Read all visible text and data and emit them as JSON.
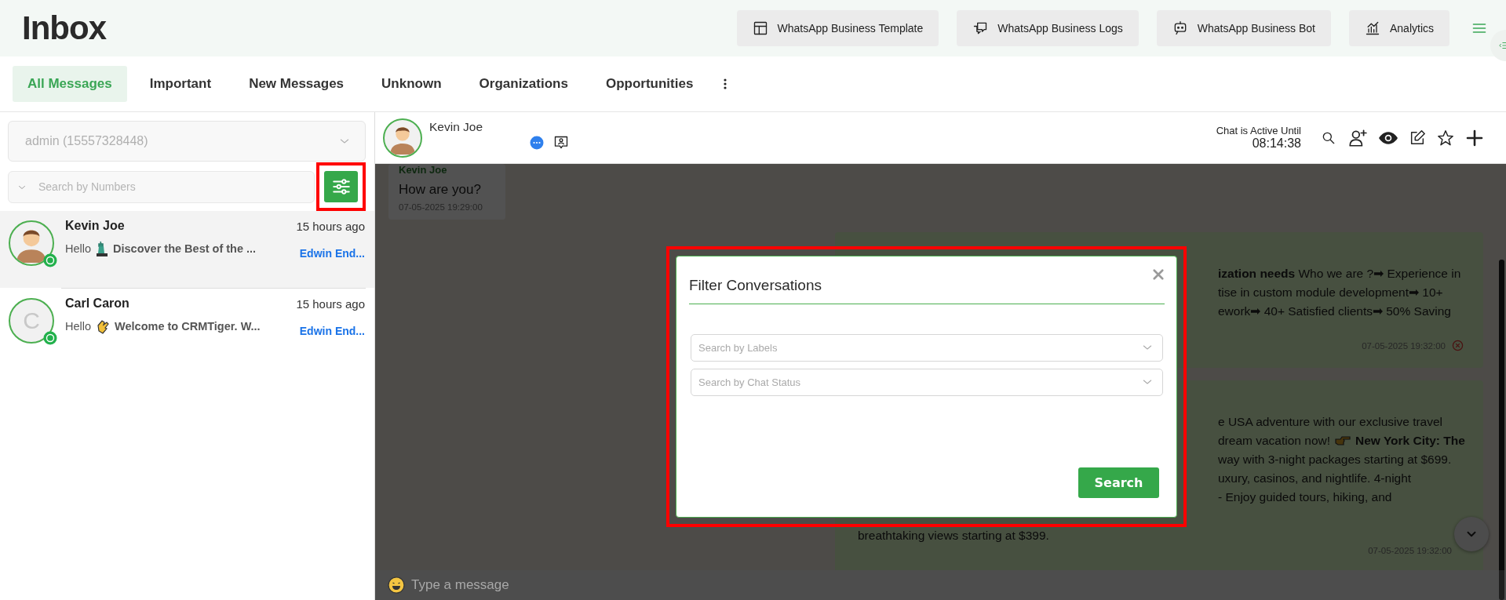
{
  "header": {
    "title": "Inbox",
    "buttons": [
      {
        "label": "WhatsApp Business Template",
        "kind": "template"
      },
      {
        "label": "WhatsApp Business Logs",
        "kind": "logs"
      },
      {
        "label": "WhatsApp Business Bot",
        "kind": "bot"
      },
      {
        "label": "Analytics",
        "kind": "analytics"
      }
    ]
  },
  "tabs": [
    {
      "label": "All Messages",
      "selected": true
    },
    {
      "label": "Important",
      "selected": false
    },
    {
      "label": "New Messages",
      "selected": false
    },
    {
      "label": "Unknown",
      "selected": false
    },
    {
      "label": "Organizations",
      "selected": false
    },
    {
      "label": "Opportunities",
      "selected": false
    }
  ],
  "sidebar": {
    "account_select": {
      "value": "admin (15557328448)"
    },
    "search": {
      "placeholder": "Search by Numbers"
    }
  },
  "contacts": [
    {
      "name": "Kevin Joe",
      "time": "15 hours ago",
      "preview": [
        {
          "kind": "text",
          "text": "Hello"
        },
        {
          "kind": "statue"
        },
        {
          "kind": "text",
          "text": "**Discover the Best of the ...**"
        }
      ],
      "agent": "Edwin End...",
      "avatar": {
        "kind": "photo"
      },
      "selected": true
    },
    {
      "name": "Carl Caron",
      "time": "15 hours ago",
      "preview": [
        {
          "kind": "text",
          "text": "Hello"
        },
        {
          "kind": "clap"
        },
        {
          "kind": "text",
          "text": "**Welcome to CRMTiger. W...**"
        }
      ],
      "agent": "Edwin End...",
      "avatar": {
        "kind": "initial",
        "initial": "C"
      },
      "selected": false
    }
  ],
  "chat": {
    "name": "Kevin Joe",
    "active_label": "Chat is Active Until",
    "active_time": "08:14:38",
    "messages": [
      {
        "kind": "incoming",
        "sender": "Kevin Joe",
        "lines": [
          {
            "text": "How are you?"
          }
        ],
        "time": "07-05-2025 19:29:00",
        "failed": false
      },
      {
        "kind": "outgoing",
        "lines": [
          {
            "text": "**ization needs** Who we are ?➡ Experience in"
          },
          {
            "text": "tise in custom module development➡ 10+"
          },
          {
            "text": "ework➡ 40+ Satisfied clients➡ 50% Saving"
          }
        ],
        "time": "07-05-2025 19:32:00",
        "failed": true
      },
      {
        "kind": "outgoing",
        "lines": [
          {
            "text": "e USA adventure with our exclusive travel"
          },
          {
            "parts": [
              {
                "kind": "text",
                "text": "dream vacation now!"
              },
              {
                "kind": "point"
              },
              {
                "kind": "text",
                "text": "**New York City: The**"
              }
            ]
          },
          {
            "text": "way with 3-night packages starting at $699."
          },
          {
            "text": "uxury, casinos, and nightlife. 4-night"
          },
          {
            "text": "- Enjoy guided tours, hiking, and"
          }
        ],
        "footer_line": "breathtaking views starting at $399.",
        "time": "07-05-2025 19:32:00",
        "failed": false
      }
    ],
    "input": {
      "placeholder": "Type a message"
    }
  },
  "modal": {
    "title": "Filter Conversations",
    "fields": [
      {
        "placeholder": "Search by Labels"
      },
      {
        "placeholder": "Search by Chat Status"
      }
    ],
    "button": "Search"
  }
}
